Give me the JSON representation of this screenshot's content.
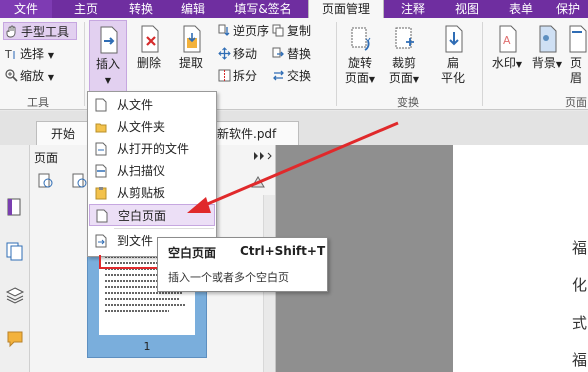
{
  "menu": {
    "tabs": [
      "文件",
      "主页",
      "转换",
      "编辑",
      "填写&签名",
      "页面管理",
      "注释",
      "视图",
      "表单",
      "保护"
    ],
    "active": "页面管理"
  },
  "ribbon": {
    "tools_group": {
      "hand_tool": "手型工具",
      "select": "选择",
      "zoom": "缩放",
      "label": "工具"
    },
    "insert": "插入",
    "delete": "删除",
    "extract": "提取",
    "small_buttons": {
      "reverse": "逆页序",
      "move": "移动",
      "split": "拆分",
      "copy": "复制",
      "replace": "替换",
      "swap": "交换"
    },
    "rotate": [
      "旋转",
      "页面"
    ],
    "crop": [
      "裁剪",
      "页面"
    ],
    "flatten": [
      "扁",
      "平化"
    ],
    "transform_label": "变换",
    "watermark": "水印",
    "background": "背景",
    "page_partial": [
      "页",
      "眉"
    ],
    "page_label_partial": "页面"
  },
  "doc_tabs": {
    "start": "开始",
    "file_suffix": "新软件.pdf"
  },
  "pages_panel": {
    "title": "页面",
    "page_number": "1"
  },
  "dropdown": {
    "items": [
      "从文件",
      "从文件夹",
      "从打开的文件",
      "从扫描仪",
      "从剪贴板",
      "空白页面",
      "到文件"
    ],
    "selected": "空白页面"
  },
  "tooltip": {
    "title": "空白页面",
    "shortcut": "Ctrl+Shift+T",
    "description": "插入一个或者多个空白页"
  },
  "document": {
    "visible_chars": [
      "福",
      "化",
      "式",
      "福"
    ]
  },
  "colors": {
    "accent": "#6f2ea0",
    "arrow": "#e0292b",
    "selection": "#ecdff6"
  }
}
